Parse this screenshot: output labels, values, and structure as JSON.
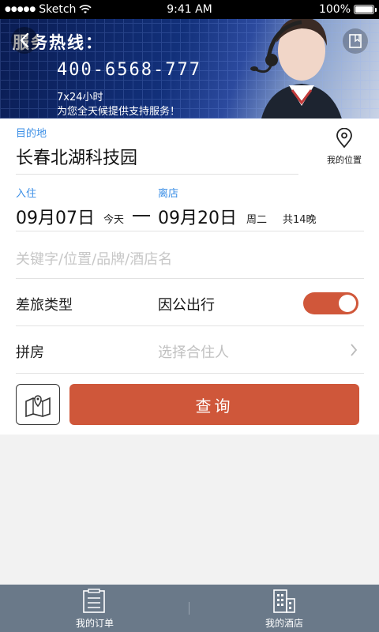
{
  "status_bar": {
    "carrier": "Sketch",
    "time": "9:41 AM",
    "battery": "100%"
  },
  "banner": {
    "title": "服务热线：",
    "hotline": "400-6568-777",
    "hours": "7x24小时",
    "support": "为您全天候提供支持服务！"
  },
  "form": {
    "destination_label": "目的地",
    "destination_value": "长春北湖科技园",
    "my_location_label": "我的位置",
    "checkin_label": "入住",
    "checkin_date": "09月07日",
    "checkin_day": "今天",
    "checkout_label": "离店",
    "checkout_date": "09月20日",
    "checkout_day": "周二",
    "nights": "共14晚",
    "keyword_placeholder": "关键字/位置/品牌/酒店名",
    "trip_type_label": "差旅类型",
    "trip_type_value": "因公出行",
    "trip_toggle_on": true,
    "roommate_label": "拼房",
    "roommate_placeholder": "选择合住人",
    "query_button": "查询"
  },
  "tab_bar": {
    "tabs": [
      {
        "label": "我的订单",
        "icon": "clipboard-icon"
      },
      {
        "label": "我的酒店",
        "icon": "building-icon"
      }
    ]
  },
  "colors": {
    "accent": "#cf573a",
    "blue_label": "#3a8ee6",
    "tab_bar": "#6a7989"
  }
}
